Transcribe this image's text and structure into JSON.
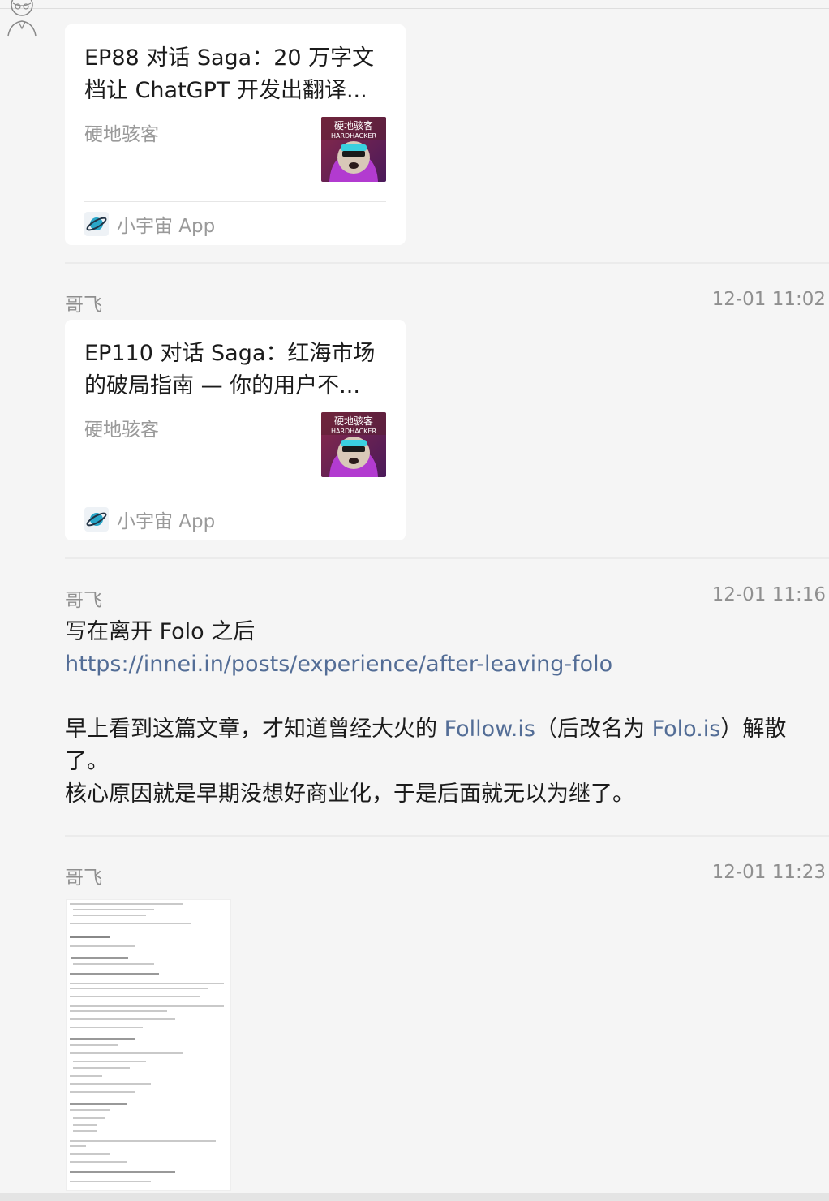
{
  "messages": [
    {
      "sender": "",
      "time": "",
      "card": {
        "title": "EP88 对话 Saga：20 万字文档让 ChatGPT 开发出翻译...",
        "source": "硬地骇客",
        "thumb_text_cn": "硬地骇客",
        "thumb_text_en": "HARDHACKER",
        "app": "小宇宙 App"
      }
    },
    {
      "sender": "哥飞",
      "time": "12-01 11:02",
      "card": {
        "title": "EP110 对话 Saga：红海市场的破局指南 — 你的用户不...",
        "source": "硬地骇客",
        "thumb_text_cn": "硬地骇客",
        "thumb_text_en": "HARDHACKER",
        "app": "小宇宙 App"
      }
    },
    {
      "sender": "哥飞",
      "time": "12-01 11:16",
      "text": {
        "line1": "写在离开 Folo 之后",
        "url": "https://innei.in/posts/experience/after-leaving-folo",
        "p1_a": "早上看到这篇文章，才知道曾经大火的 ",
        "p1_link1": "Follow.is",
        "p1_b": "（后改名为 ",
        "p1_link2": "Folo.is",
        "p1_c": "）解散了。",
        "p2": "核心原因就是早期没想好商业化，于是后面就无以为继了。"
      }
    },
    {
      "sender": "哥飞",
      "time": "12-01 11:23",
      "image": "document-screenshot"
    }
  ],
  "colors": {
    "background": "#f5f5f5",
    "card": "#ffffff",
    "link": "#536d96",
    "meta": "#8f8f8f"
  }
}
